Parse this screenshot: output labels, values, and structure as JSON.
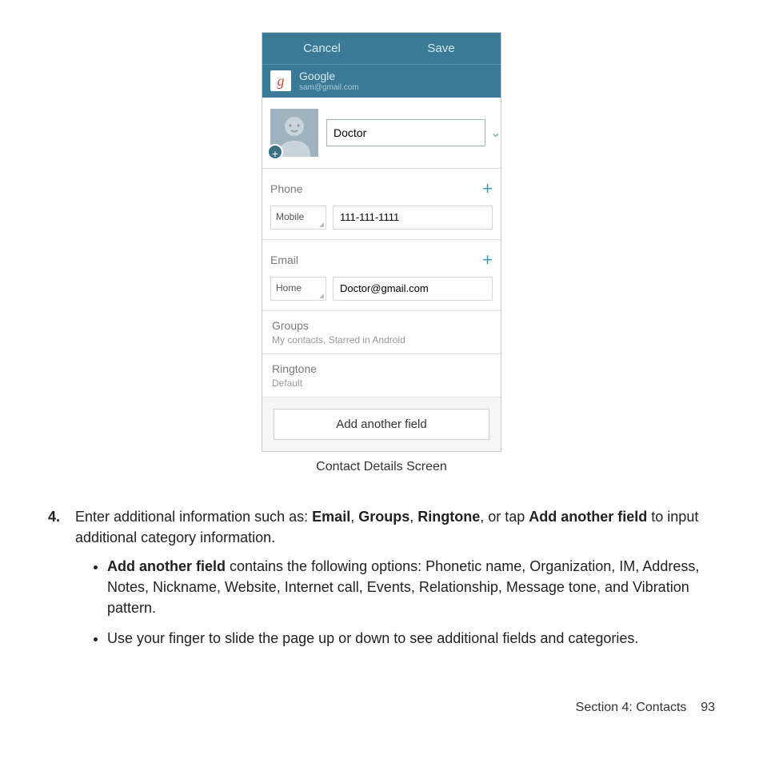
{
  "screenshot": {
    "topbar": {
      "cancel": "Cancel",
      "save": "Save"
    },
    "account": {
      "provider": "Google",
      "email": "sam@gmail.com",
      "icon_letter": "g"
    },
    "name_value": "Doctor",
    "phone": {
      "label": "Phone",
      "type": "Mobile",
      "value": "111-111-1111"
    },
    "email": {
      "label": "Email",
      "type": "Home",
      "value": "Doctor@gmail.com"
    },
    "groups": {
      "label": "Groups",
      "value": "My contacts, Starred in Android"
    },
    "ringtone": {
      "label": "Ringtone",
      "value": "Default"
    },
    "add_field": "Add another field"
  },
  "caption": "Contact Details Screen",
  "step_number": "4.",
  "step_text_parts": {
    "p1": "Enter additional information such as: ",
    "b1": "Email",
    "c1": ", ",
    "b2": "Groups",
    "c2": ", ",
    "b3": "Ringtone",
    "c3": ", or tap ",
    "b4": "Add another field",
    "p2": " to input additional category information."
  },
  "bullet1": {
    "bold": "Add another field",
    "rest": " contains the following options: Phonetic name, Organization, IM, Address, Notes, Nickname, Website, Internet call, Events, Relationship, Message tone, and Vibration pattern."
  },
  "bullet2": "Use your finger to slide the page up or down to see additional fields and categories.",
  "footer": {
    "section": "Section 4:  Contacts",
    "page": "93"
  }
}
